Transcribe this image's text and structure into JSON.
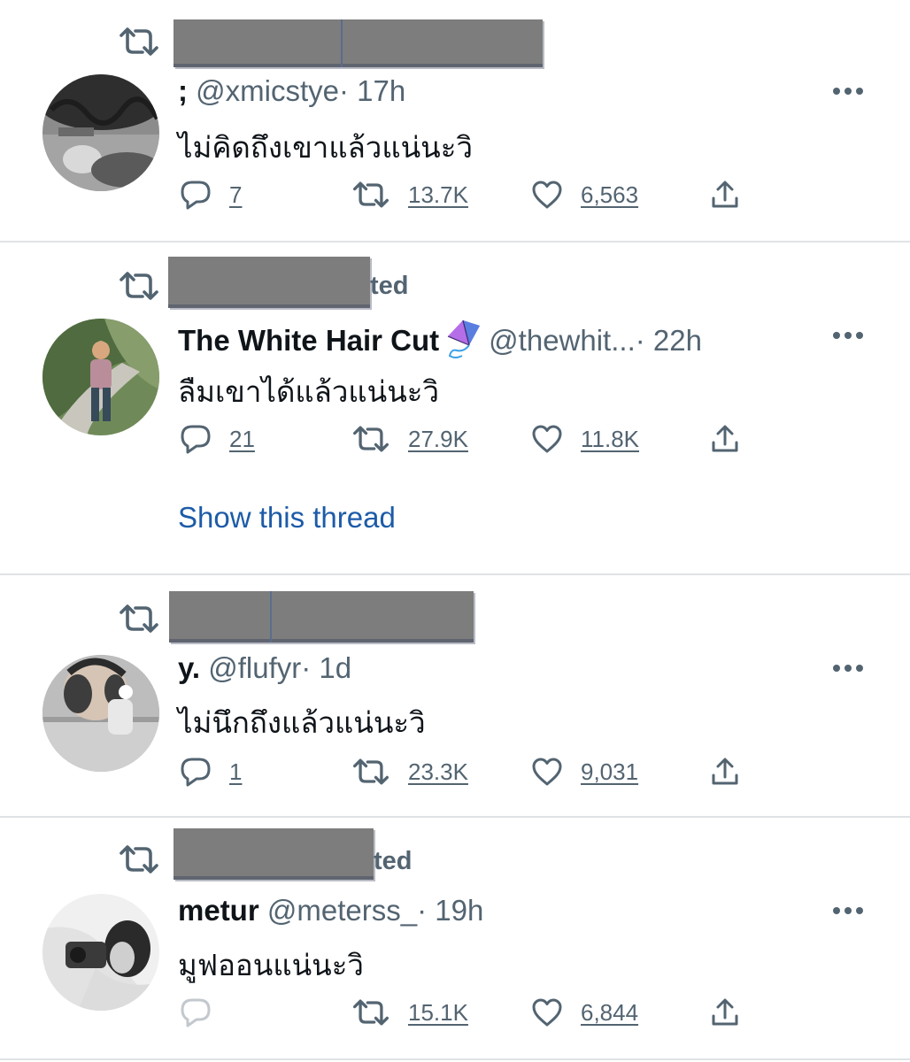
{
  "tweets": [
    {
      "retweeted_suffix": "",
      "name": ";",
      "handle": "@xmicstye",
      "time": "· 17h",
      "text": "ไม่คิดถึงเขาแล้วแน่นะวิ",
      "reply_count": "7",
      "retweet_count": "13.7K",
      "like_count": "6,563"
    },
    {
      "retweeted_suffix": "ted",
      "name": "The White Hair Cut",
      "name_emoji": "kite-icon",
      "handle": "@thewhit...",
      "time": "· 22h",
      "text": "ลืมเขาได้แล้วแน่นะวิ",
      "reply_count": "21",
      "retweet_count": "27.9K",
      "like_count": "11.8K",
      "show_thread": "Show this thread"
    },
    {
      "retweeted_suffix": "",
      "name": "y.",
      "handle": "@flufyr",
      "time": "· 1d",
      "text": "ไม่นึกถึงแล้วแน่นะวิ",
      "reply_count": "1",
      "retweet_count": "23.3K",
      "like_count": "9,031"
    },
    {
      "retweeted_suffix": "ted",
      "name": "metur",
      "handle": "@meterss_",
      "time": "· 19h",
      "text": "มูฟออนแน่นะวิ",
      "reply_count": "",
      "retweet_count": "15.1K",
      "like_count": "6,844"
    }
  ],
  "colors": {
    "text": "#0f1419",
    "secondary": "#536471",
    "link": "#1d5ba8",
    "divider": "#dfe3e6",
    "redaction": "#7d7d7d"
  },
  "icons": [
    "retweet-icon",
    "reply-icon",
    "like-icon",
    "share-icon",
    "more-icon",
    "kite-icon"
  ]
}
